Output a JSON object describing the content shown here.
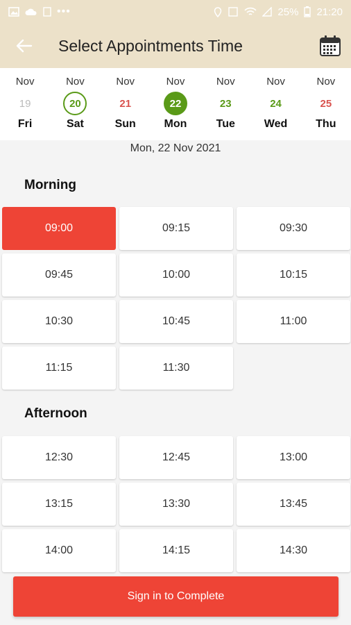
{
  "status_bar": {
    "battery": "25%",
    "time": "21:20"
  },
  "appbar": {
    "title": "Select Appointments Time"
  },
  "days": [
    {
      "month": "Nov",
      "date": "19",
      "weekday": "Fri",
      "state": "past"
    },
    {
      "month": "Nov",
      "date": "20",
      "weekday": "Sat",
      "state": "outline"
    },
    {
      "month": "Nov",
      "date": "21",
      "weekday": "Sun",
      "state": "red"
    },
    {
      "month": "Nov",
      "date": "22",
      "weekday": "Mon",
      "state": "selected"
    },
    {
      "month": "Nov",
      "date": "23",
      "weekday": "Tue",
      "state": "green"
    },
    {
      "month": "Nov",
      "date": "24",
      "weekday": "Wed",
      "state": "green"
    },
    {
      "month": "Nov",
      "date": "25",
      "weekday": "Thu",
      "state": "red"
    }
  ],
  "selected_date_label": "Mon, 22 Nov 2021",
  "morning": {
    "title": "Morning",
    "slots": [
      "09:00",
      "09:15",
      "09:30",
      "09:45",
      "10:00",
      "10:15",
      "10:30",
      "10:45",
      "11:00",
      "11:15",
      "11:30"
    ],
    "selected": "09:00"
  },
  "afternoon": {
    "title": "Afternoon",
    "slots": [
      "12:30",
      "12:45",
      "13:00",
      "13:15",
      "13:30",
      "13:45",
      "14:00",
      "14:15",
      "14:30"
    ]
  },
  "cta": {
    "label": "Sign in to Complete"
  },
  "colors": {
    "accent": "#ee4436",
    "green": "#5a9a18",
    "header_bg": "#ece1c9"
  }
}
